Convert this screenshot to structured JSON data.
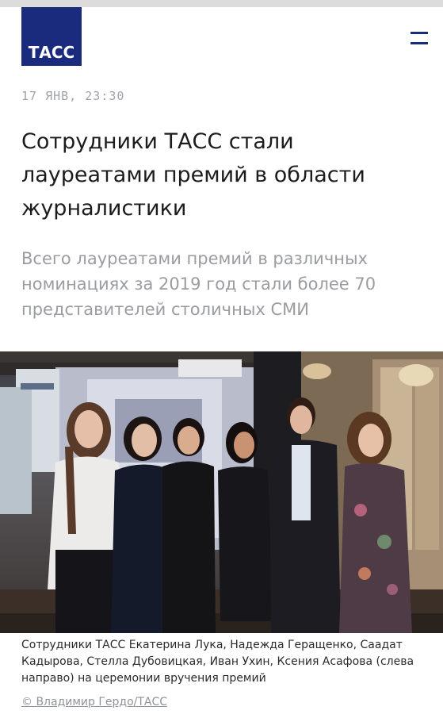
{
  "header": {
    "logo_text": "ТАСС"
  },
  "article": {
    "date": "17 ЯНВ, 23:30",
    "title": "Сотрудники ТАСС стали лауреатами премий в области журналистики",
    "lead": "Всего лауреатами премий в различных номинациях за 2019 год стали более 70 представителей столичных СМИ",
    "photo": {
      "caption": "Сотрудники ТАСС Екатерина Лука, Надежда Геращенко, Саадат Кадырова, Стелла Дубовицкая, Иван Ухин, Ксения Асафова (слева направо) на церемонии вручения премий",
      "credit": "© Владимир Гердо/ТАСС"
    }
  },
  "colors": {
    "brand": "#1a2b7d",
    "date": "#a0a4a8",
    "title": "#1c1c1c",
    "lead": "#9a9ca0"
  }
}
